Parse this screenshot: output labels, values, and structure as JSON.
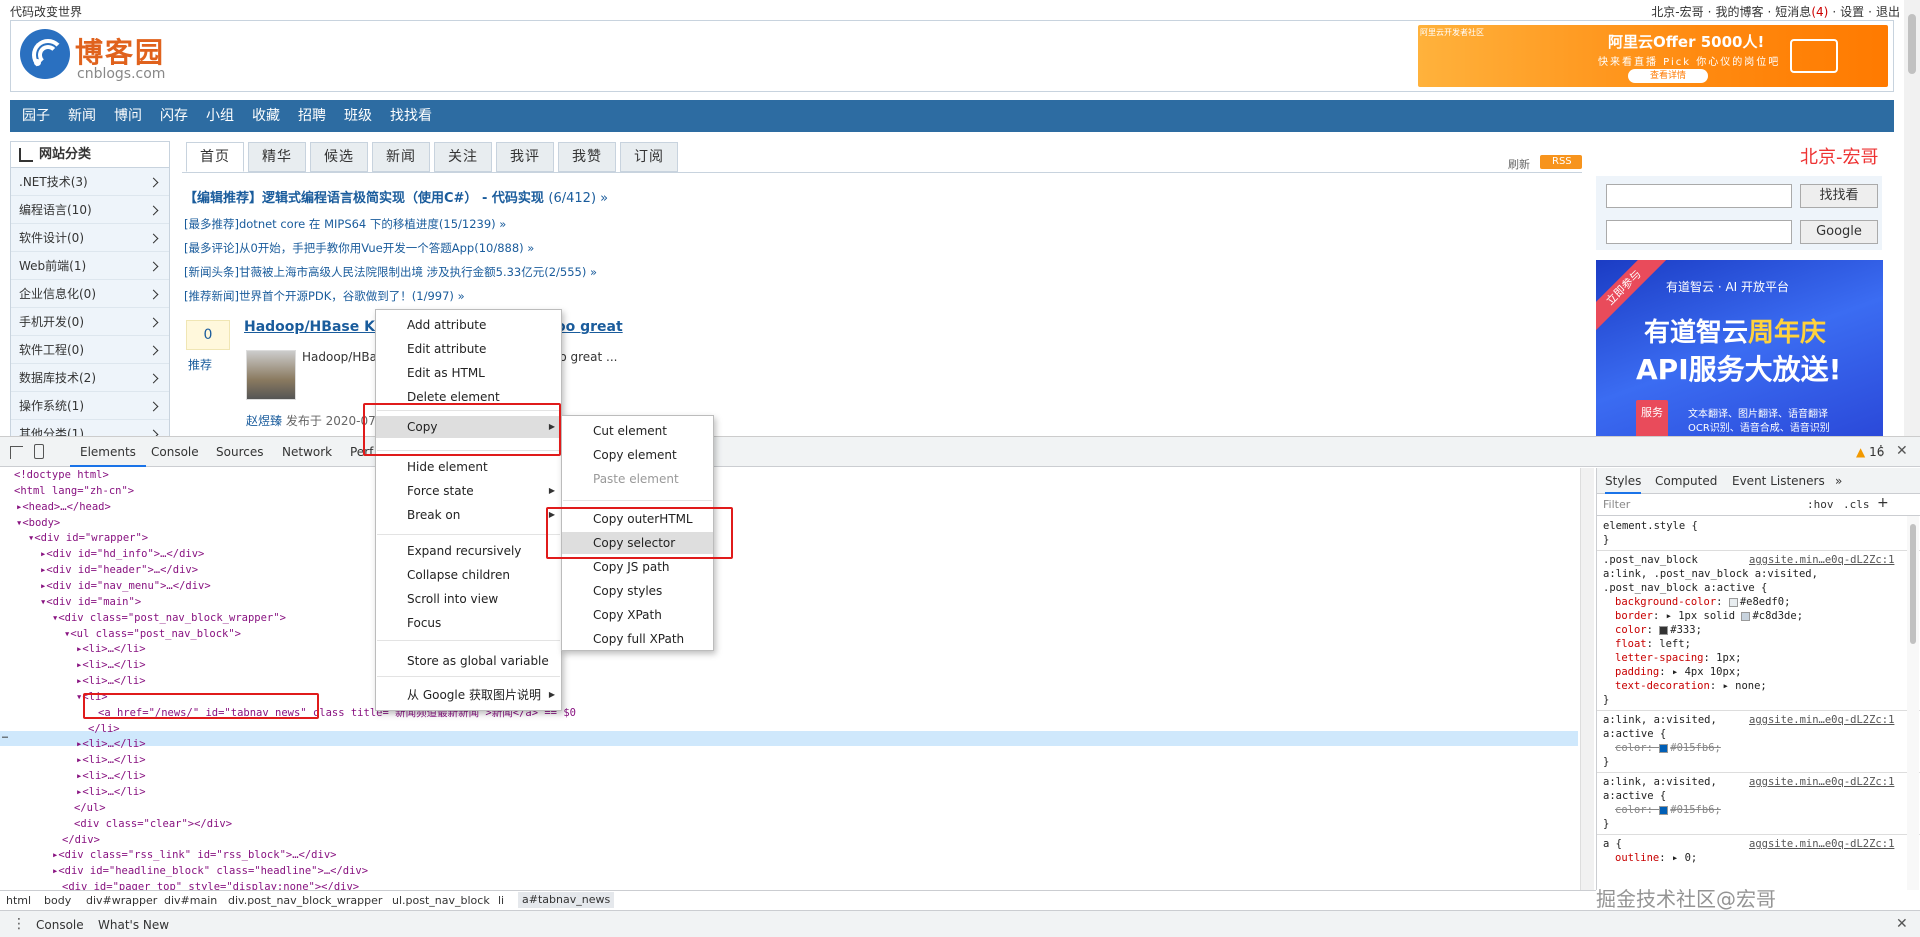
{
  "topbar": {
    "slogan": "代码改变世界",
    "user": "北京-宏哥",
    "sep1": "·",
    "my_blog": "我的博客",
    "sep2": "·",
    "messages": "短消息",
    "msg_count": "(4)",
    "sep3": "·",
    "settings": "设置",
    "sep4": "·",
    "logout": "退出"
  },
  "header": {
    "logo_text": "博客园",
    "logo_sub": "cnblogs.com",
    "ad_tag": "阿里云开发者社区",
    "ad_title": "阿里云Offer 5000人!",
    "ad_sub": "快来看直播 Pick 你心仪的岗位吧",
    "ad_button": "查看详情"
  },
  "nav_menu": [
    "园子",
    "新闻",
    "博问",
    "闪存",
    "小组",
    "收藏",
    "招聘",
    "班级",
    "找找看"
  ],
  "categories": {
    "title": "网站分类",
    "items": [
      ".NET技术(3)",
      "编程语言(10)",
      "软件设计(0)",
      "Web前端(1)",
      "企业信息化(0)",
      "手机开发(0)",
      "软件工程(0)",
      "数据库技术(2)",
      "操作系统(1)",
      "其他分类(1)"
    ]
  },
  "tabs": [
    "首页",
    "精华",
    "候选",
    "新闻",
    "关注",
    "我评",
    "我赞",
    "订阅"
  ],
  "refresh": "刷新",
  "rss": "RSS",
  "headlines": {
    "main": "【编辑推荐】逻辑式编程语言极简实现（使用C#） - 代码实现",
    "main_count": "(6/412) »",
    "items": [
      "[最多推荐]dotnet core 在 MIPS64 下的移植进度(15/1239) »",
      "[最多评论]从0开始，手把手教你用Vue开发一个答题App(10/888) »",
      "[新闻头条]甘薇被上海市高级人民法院限制出境 涉及执行金额5.33亿元(2/555) »",
      "[推荐新闻]世界首个开源PDK，谷歌做到了！(1/997) »"
    ]
  },
  "post": {
    "digg": "0",
    "digg_label": "推荐",
    "title_left": "Hadoop/HBase Ker",
    "title_right": "oo great",
    "summary_left": "Hadoop/HBas",
    "summary_right": "oo great ...",
    "author": "赵煜臻",
    "published": " 发布于 2020-07"
  },
  "right_col": {
    "user": "北京-宏哥",
    "search1_btn": "找找看",
    "search2_btn": "Google",
    "ad_ribbon": "立即参与",
    "ad_brand": "有道智云 · AI 开放平台",
    "ad_line1_a": "有道智云",
    "ad_line1_b": "周年庆",
    "ad_line2": "API服务大放送!",
    "ad_badge": "服务",
    "ad_feat1": "文本翻译、图片翻译、语音翻译",
    "ad_feat2": "OCR识别、语音合成、语音识别"
  },
  "devtools": {
    "tabs": [
      "Elements",
      "Console",
      "Sources",
      "Network",
      "Perf"
    ],
    "warn_icon": "▲",
    "warn_count": "16",
    "more": "⋮",
    "close": "✕",
    "dom": [
      {
        "text": "<!doctype html>"
      },
      {
        "text": "<html lang=\"zh-cn\">"
      },
      {
        "text": "▸<head>…</head>"
      },
      {
        "text": "▾<body>"
      },
      {
        "text": "▾<div id=\"wrapper\">"
      },
      {
        "text": "▸<div id=\"hd_info\">…</div>"
      },
      {
        "text": "▸<div id=\"header\">…</div>"
      },
      {
        "text": "▸<div id=\"nav_menu\">…</div>"
      },
      {
        "text": "▾<div id=\"main\">"
      },
      {
        "text": "▾<div class=\"post_nav_block_wrapper\">"
      },
      {
        "text": "▾<ul class=\"post_nav_block\">"
      },
      {
        "text": "▸<li>…</li>"
      },
      {
        "text": "▸<li>…</li>"
      },
      {
        "text": "▸<li>…</li>"
      },
      {
        "text": "▾<li>"
      },
      {
        "text": "<a href=\"/news/\" id=\"tabnav_news\" class title=\"新闻频道最新新闻\">新闻</a> == $0"
      },
      {
        "text": "</li>"
      },
      {
        "text": "▸<li>…</li>"
      },
      {
        "text": "▸<li>…</li>"
      },
      {
        "text": "▸<li>…</li>"
      },
      {
        "text": "▸<li>…</li>"
      },
      {
        "text": "</ul>"
      },
      {
        "text": "<div class=\"clear\"></div>"
      },
      {
        "text": "</div>"
      },
      {
        "text": "▸<div class=\"rss_link\" id=\"rss_block\">…</div>"
      },
      {
        "text": "▸<div id=\"headline_block\" class=\"headline\">…</div>"
      },
      {
        "text": "<div id=\"pager_top\" style=\"display:none\"></div>"
      }
    ],
    "row_dots": "…",
    "styles_tabs": [
      "Styles",
      "Computed",
      "Event Listeners",
      "»"
    ],
    "filter_placeholder": "Filter",
    "hov": ":hov",
    "cls": ".cls",
    "plus": "+",
    "element_style": "element.style {",
    "close_brace": "}",
    "rule1": {
      "selector1": ".post_nav_block",
      "source": "aggsite.min…e0q-dL2Zc:1",
      "selector2": "a:link, .post_nav_block a:visited,",
      "selector3": ".post_nav_block a:active {",
      "props": [
        {
          "name": "background-color",
          "value": "#e8edf0",
          "swatch": "#e8edf0"
        },
        {
          "name": "border",
          "value": "▸ 1px solid ",
          "value2": "#c8d3de",
          "swatch": "#c8d3de"
        },
        {
          "name": "color",
          "value": "#333",
          "swatch": "#333333"
        },
        {
          "name": "float",
          "value": "left"
        },
        {
          "name": "letter-spacing",
          "value": "1px"
        },
        {
          "name": "padding",
          "value": "▸ 4px 10px"
        },
        {
          "name": "text-decoration",
          "value": "▸ none"
        }
      ]
    },
    "rule2": {
      "selector1": "a:link, a:visited,",
      "selector2": "a:active {",
      "source": "aggsite.min…e0q-dL2Zc:1",
      "prop": "color",
      "value": "#015fb6",
      "swatch": "#015fb6"
    },
    "rule3": {
      "selector1": "a:link, a:visited,",
      "selector2": "a:active {",
      "source": "aggsite.min…e0q-dL2Zc:1",
      "prop": "color",
      "value": "#015fb6",
      "swatch": "#015fb6"
    },
    "rule4": {
      "selector": "a {",
      "source": "aggsite.min…e0q-dL2Zc:1",
      "prop": "outline",
      "value": "▸ 0"
    },
    "breadcrumb": [
      "html",
      "body",
      "div#wrapper",
      "div#main",
      "div.post_nav_block_wrapper",
      "ul.post_nav_block",
      "li",
      "a#tabnav_news"
    ],
    "drawer_tabs": [
      "Console",
      "What's New"
    ],
    "watermark": "掘金技术社区@宏哥"
  },
  "context_menu": {
    "items": [
      "Add attribute",
      "Edit attribute",
      "Edit as HTML",
      "Delete element",
      "Copy",
      "Hide element",
      "Force state",
      "Break on",
      "Expand recursively",
      "Collapse children",
      "Scroll into view",
      "Focus",
      "Store as global variable",
      "从 Google 获取图片说明"
    ],
    "submenu_arrow": "▶"
  },
  "copy_submenu": {
    "items": [
      "Cut element",
      "Copy element",
      "Paste element",
      "Copy outerHTML",
      "Copy selector",
      "Copy JS path",
      "Copy styles",
      "Copy XPath",
      "Copy full XPath"
    ]
  }
}
